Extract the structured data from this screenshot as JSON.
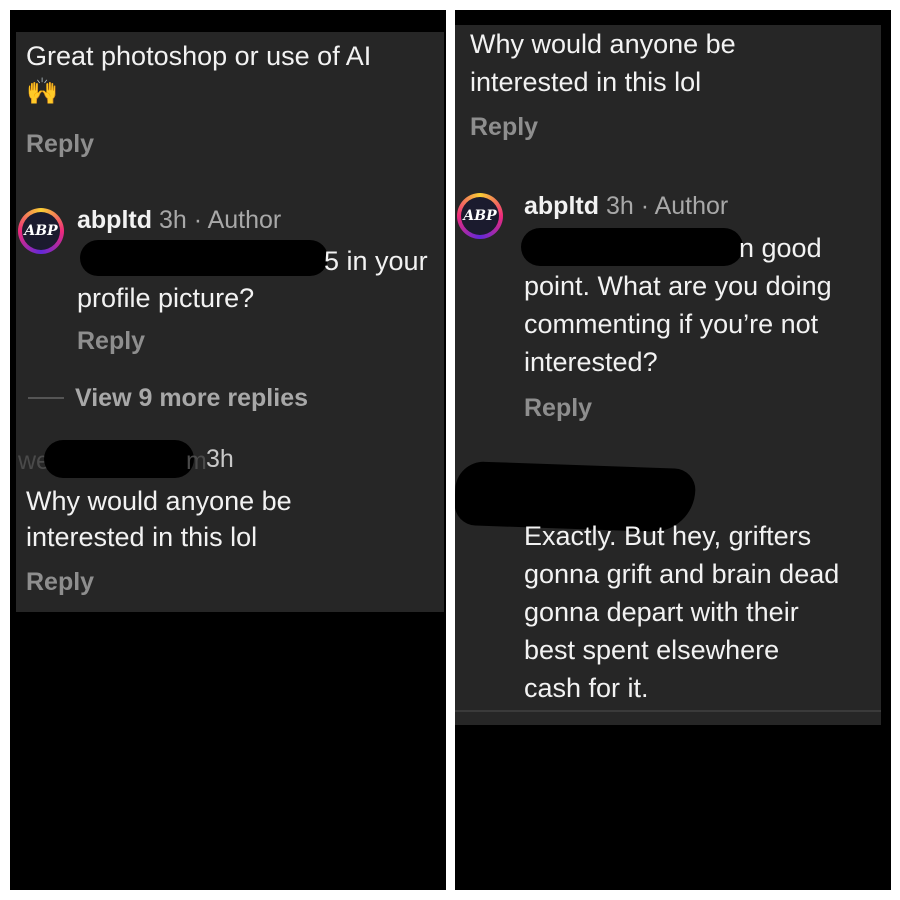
{
  "left": {
    "comment1": {
      "text": "Great photoshop or use of AI",
      "emoji": "🙌",
      "reply": "Reply"
    },
    "author_reply": {
      "avatar_text": "ABP",
      "handle": "abpltd",
      "meta": " 3h · Author",
      "text_line1": "5 in your",
      "text_line2": "profile picture?",
      "reply": "Reply"
    },
    "view_more": "View 9 more replies",
    "comment2": {
      "handle_partial_start": "we",
      "handle_partial_end": "m",
      "time": "3h",
      "text_line1": "Why would anyone be",
      "text_line2": "interested in this lol",
      "reply": "Reply"
    }
  },
  "right": {
    "comment1": {
      "text_line1": "Why would anyone be",
      "text_line2": "interested in this lol",
      "reply": "Reply"
    },
    "author_reply": {
      "avatar_text": "ABP",
      "handle": "abpltd",
      "meta": " 3h · Author",
      "text_line1": "n good",
      "text_line2": "point. What are you doing",
      "text_line3": "commenting if you’re not",
      "text_line4": "interested?",
      "reply": "Reply"
    },
    "comment3": {
      "line1": "Exactly.  But hey,  grifters",
      "line2": "gonna grift and brain dead",
      "line3": "gonna depart with their",
      "line4": "best spent elsewhere",
      "line5": "cash for it."
    }
  }
}
